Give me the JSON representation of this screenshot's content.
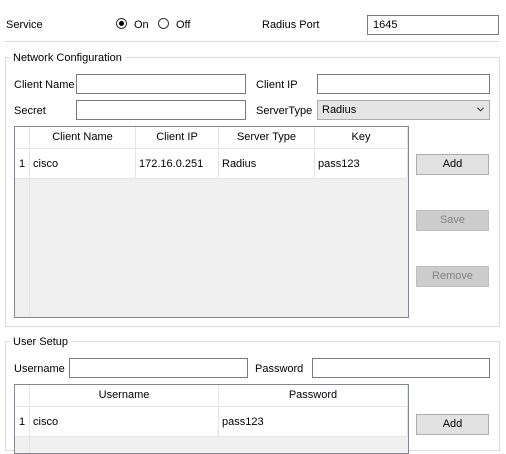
{
  "service": {
    "label": "Service",
    "on_label": "On",
    "off_label": "Off",
    "selected": "On",
    "radius_port_label": "Radius Port",
    "radius_port_value": "1645"
  },
  "network_config": {
    "title": "Network Configuration",
    "client_name_label": "Client Name",
    "client_name_value": "",
    "client_ip_label": "Client IP",
    "client_ip_value": "",
    "secret_label": "Secret",
    "secret_value": "",
    "server_type_label": "ServerType",
    "server_type_value": "Radius",
    "table": {
      "headers": [
        "Client Name",
        "Client IP",
        "Server Type",
        "Key"
      ],
      "rows": [
        {
          "index": "1",
          "client_name": "cisco",
          "client_ip": "172.16.0.251",
          "server_type": "Radius",
          "key": "pass123"
        }
      ]
    },
    "buttons": {
      "add": "Add",
      "save": "Save",
      "remove": "Remove"
    }
  },
  "user_setup": {
    "title": "User Setup",
    "username_label": "Username",
    "username_value": "",
    "password_label": "Password",
    "password_value": "",
    "table": {
      "headers": [
        "Username",
        "Password"
      ],
      "rows": [
        {
          "index": "1",
          "username": "cisco",
          "password": "pass123"
        }
      ]
    },
    "buttons": {
      "add": "Add"
    }
  }
}
